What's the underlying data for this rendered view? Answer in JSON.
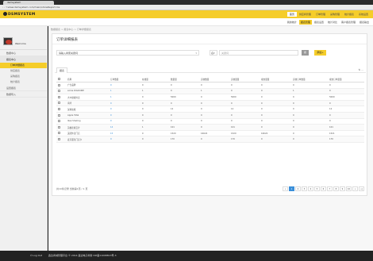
{
  "browser": {
    "tab_title": "dsmsystem",
    "nav": "‹ › ↻",
    "url": "www.dsmsystem.com/main/showReport.ms"
  },
  "header": {
    "logo": "DSMSYSTEM",
    "nav_items": [
      "首页",
      "供应商管理",
      "订单管理",
      "采购管理",
      "统计报表",
      "系统设置"
    ]
  },
  "toolbar": {
    "items": [
      "我的统计",
      "报表管理",
      "报表设置",
      "统计对比",
      "客户报表管理",
      "报表输出"
    ]
  },
  "sidebar": {
    "welcome": "Welcome",
    "items": [
      {
        "label": "数据中心"
      },
      {
        "label": "报表中心",
        "children": [
          "订单详细报表",
          "供应报表",
          "采购报表",
          "统计报表"
        ]
      },
      {
        "label": "设置报表"
      },
      {
        "label": "数据导入"
      }
    ]
  },
  "main": {
    "breadcrumb": "数据报表 > 报表中心 > 订单详细报表",
    "title": "订单详细报表",
    "filter": {
      "select_value": "请输入商家关键词",
      "caret": "▾",
      "qsel": "名▾",
      "search_placeholder": "关键词",
      "search_label": "搜",
      "add_label": "添加+"
    },
    "table_tab": "报表",
    "table_tools": "⇅  ⋯",
    "columns": [
      "",
      "名称",
      "订单数量",
      "在线量",
      "数量量",
      "实收数量",
      "实收量量",
      "成交量量",
      "实收订单数量",
      "成交订单量量"
    ],
    "rows": [
      [
        "广告品牌",
        "0",
        "0",
        "0",
        "0",
        "0",
        "0",
        "0",
        "0"
      ],
      [
        "Acme DIGICORE",
        "1",
        "1",
        "0",
        "1",
        "0",
        "0",
        "1",
        "0"
      ],
      [
        "大众健康外卖",
        "1",
        "0",
        "5000",
        "0",
        "5000",
        "0",
        "0",
        "5000"
      ],
      [
        "海湾",
        "0",
        "0",
        "0",
        "0",
        "0",
        "0",
        "0",
        "0"
      ],
      [
        "深圳航旅",
        "0",
        "0",
        "12",
        "0",
        "12",
        "0",
        "0",
        "12"
      ],
      [
        "Apple Total",
        "0",
        "0",
        "0",
        "0",
        "0",
        "0",
        "0",
        "0"
      ],
      [
        "Ikea Shaking",
        "0",
        "0",
        "0",
        "0",
        "0",
        "0",
        "0",
        "0"
      ],
      [
        "英雄走廊云计",
        "14",
        "1",
        "101",
        "0",
        "101",
        "0",
        "0",
        "101"
      ],
      [
        "美团外卖门店",
        "15",
        "0",
        "1520",
        "16022",
        "1520",
        "16022",
        "0",
        "1521"
      ],
      [
        "麦芽面包门店卡",
        "9",
        "0",
        "170",
        "0",
        "170",
        "0",
        "0",
        "170"
      ]
    ],
    "page_info": "共10条记录 当前第1页 / 1 页",
    "pagination": [
      "«",
      "1",
      "2",
      "3",
      "4",
      "5",
      "6",
      "7",
      "8",
      "9",
      "10",
      "»",
      "»|"
    ]
  },
  "footer": {
    "logout": "⏻ Log Out",
    "copyright": "鑫达商城管理平台 © 2014 鑫达电子商务 ICP备11008813号-3"
  },
  "colors": {
    "accent": "#f5cd2a",
    "link": "#3a8fd9",
    "footer": "#222222"
  }
}
